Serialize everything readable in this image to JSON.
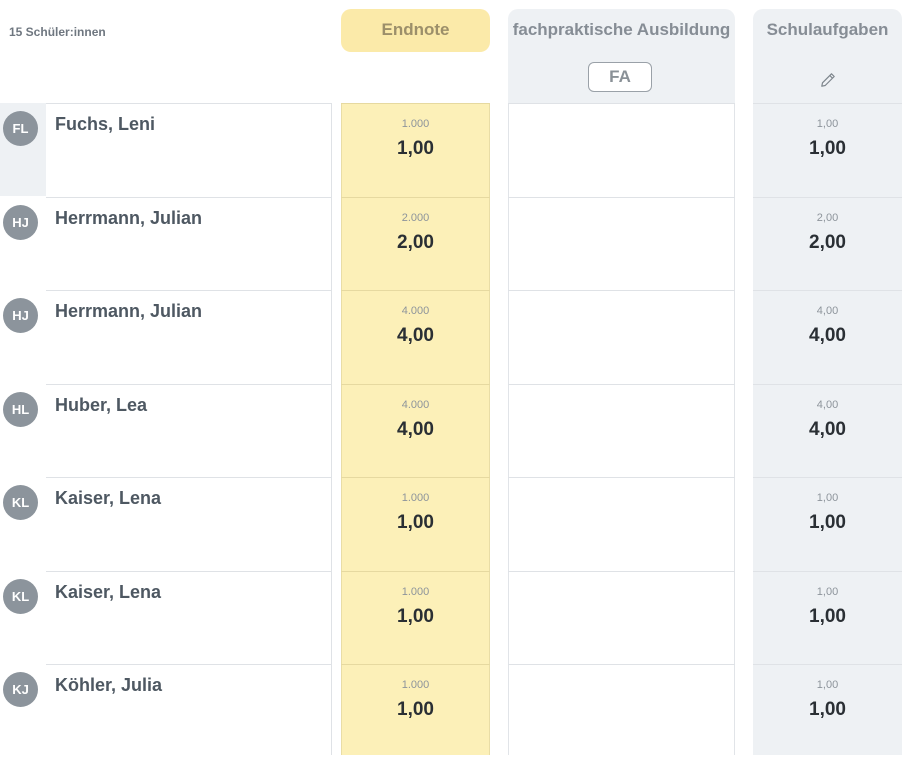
{
  "student_count": "15 Schüler:innen",
  "columns": {
    "endnote": "Endnote",
    "fpa": "fachpraktische Ausbildung",
    "fpa_badge": "FA",
    "schulaufgaben": "Schulaufgaben"
  },
  "icons": {
    "edit": "pencil-icon"
  },
  "colors": {
    "endnote_bg": "#fcf0b8",
    "header_bg": "#eef1f4",
    "avatar_bg": "#8c949c"
  },
  "rows": [
    {
      "initials": "FL",
      "name": "Fuchs, Leni",
      "endnote_raw": "1.000",
      "endnote": "1,00",
      "sa_raw": "1,00",
      "sa": "1,00"
    },
    {
      "initials": "HJ",
      "name": "Herrmann, Julian",
      "endnote_raw": "2.000",
      "endnote": "2,00",
      "sa_raw": "2,00",
      "sa": "2,00"
    },
    {
      "initials": "HJ",
      "name": "Herrmann, Julian",
      "endnote_raw": "4.000",
      "endnote": "4,00",
      "sa_raw": "4,00",
      "sa": "4,00"
    },
    {
      "initials": "HL",
      "name": "Huber, Lea",
      "endnote_raw": "4.000",
      "endnote": "4,00",
      "sa_raw": "4,00",
      "sa": "4,00"
    },
    {
      "initials": "KL",
      "name": "Kaiser, Lena",
      "endnote_raw": "1.000",
      "endnote": "1,00",
      "sa_raw": "1,00",
      "sa": "1,00"
    },
    {
      "initials": "KL",
      "name": "Kaiser, Lena",
      "endnote_raw": "1.000",
      "endnote": "1,00",
      "sa_raw": "1,00",
      "sa": "1,00"
    },
    {
      "initials": "KJ",
      "name": "Köhler, Julia",
      "endnote_raw": "1.000",
      "endnote": "1,00",
      "sa_raw": "1,00",
      "sa": "1,00"
    }
  ]
}
